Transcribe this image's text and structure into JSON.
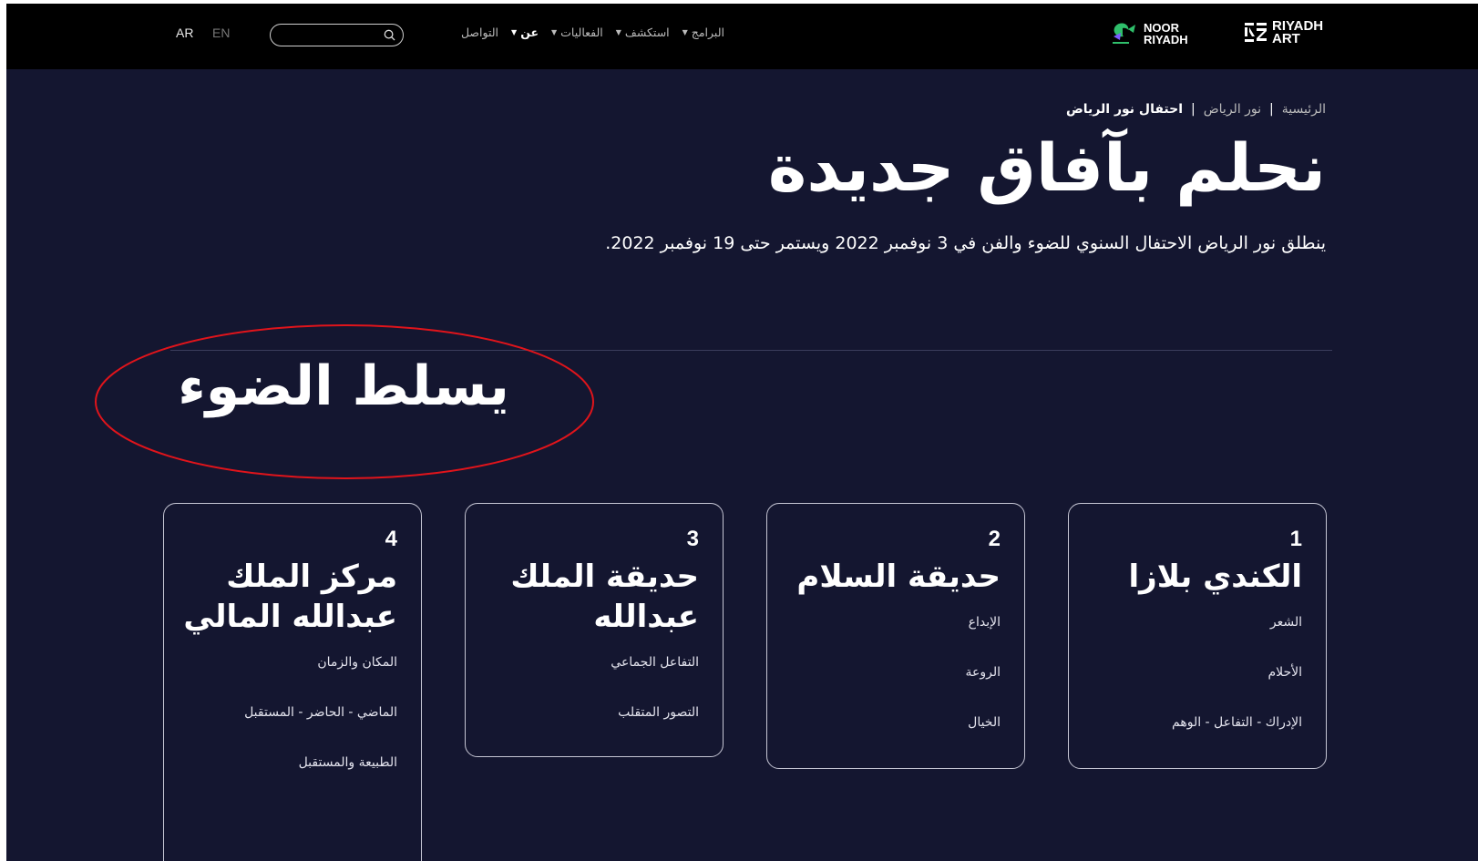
{
  "header": {
    "lang": {
      "ar": "AR",
      "en": "EN"
    },
    "search": {
      "placeholder": "",
      "icon": "search-icon"
    },
    "nav": [
      {
        "label": "البرامج",
        "has_dropdown": true
      },
      {
        "label": "استكشف",
        "has_dropdown": true
      },
      {
        "label": "الفعاليات",
        "has_dropdown": true
      },
      {
        "label": "عن",
        "has_dropdown": true
      },
      {
        "label": "التواصل",
        "has_dropdown": false
      }
    ],
    "logo_noor": {
      "line1": "NOOR",
      "line2": "RIYADH"
    },
    "logo_art": {
      "line1": "RIYADH",
      "line2": "ART"
    }
  },
  "breadcrumb": {
    "items": [
      "الرئيسية",
      "نور الرياض",
      "احتفال نور الرياض"
    ],
    "separator": "|"
  },
  "hero": {
    "title": "نحلم بآفاق جديدة",
    "subtitle": "ينطلق نور الرياض الاحتفال السنوي للضوء والفن في 3 نوفمبر 2022 ويستمر حتى 19 نوفمبر 2022."
  },
  "section": {
    "title": "يسلط الضوء"
  },
  "cards": [
    {
      "num": "1",
      "title": "الكندي بلازا",
      "items": [
        "الشعر",
        "الأحلام",
        "الإدراك - التفاعل - الوهم"
      ]
    },
    {
      "num": "2",
      "title": "حديقة السلام",
      "items": [
        "الإبداع",
        "الروعة",
        "الخيال"
      ]
    },
    {
      "num": "3",
      "title": "حديقة الملك عبدالله",
      "items": [
        "التفاعل الجماعي",
        "التصور المتقلب"
      ]
    },
    {
      "num": "4",
      "title": "مركز الملك عبدالله المالي",
      "items": [
        "المكان والزمان",
        "الماضي - الحاضر - المستقبل",
        "الطبيعة والمستقبل"
      ]
    }
  ],
  "colors": {
    "background": "#141630",
    "topbar": "#000000",
    "accent_green": "#2fbf6b",
    "annotation": "#e0141b"
  }
}
